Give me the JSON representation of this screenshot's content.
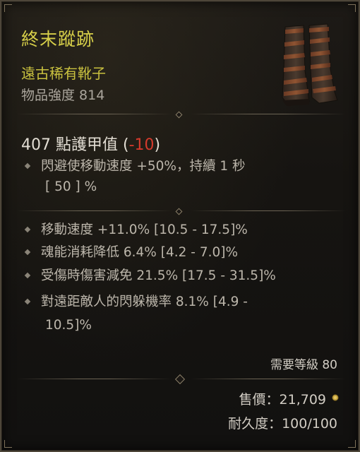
{
  "item": {
    "name": "終末蹤跡",
    "type": "遠古稀有靴子",
    "power": "物品強度 814",
    "image": "boots-icon"
  },
  "armor": {
    "text": "407 點護甲值",
    "delta_open": "(",
    "delta": "-10",
    "delta_close": ")"
  },
  "implicit": {
    "line1": "閃避使移動速度 +50%，持續 1 秒",
    "line2": "[ 50 ] %"
  },
  "affixes": [
    {
      "line1": "移動速度 +11.0% [10.5 - 17.5]%"
    },
    {
      "line1": "魂能消耗降低 6.4% [4.2 - 7.0]%"
    },
    {
      "line1": "受傷時傷害減免 21.5% [17.5 - 31.5]%"
    },
    {
      "line1": "對遠距敵人的閃躲機率 8.1% [4.9 -",
      "line2": "10.5]%"
    }
  ],
  "requirement": "需要等級 80",
  "sell_price": "售價：21,709",
  "durability": "耐久度：100/100",
  "colors": {
    "name": "#d7cf49",
    "type": "#c9c13f",
    "negative": "#d43a2c",
    "text": "#bcb6ab"
  }
}
